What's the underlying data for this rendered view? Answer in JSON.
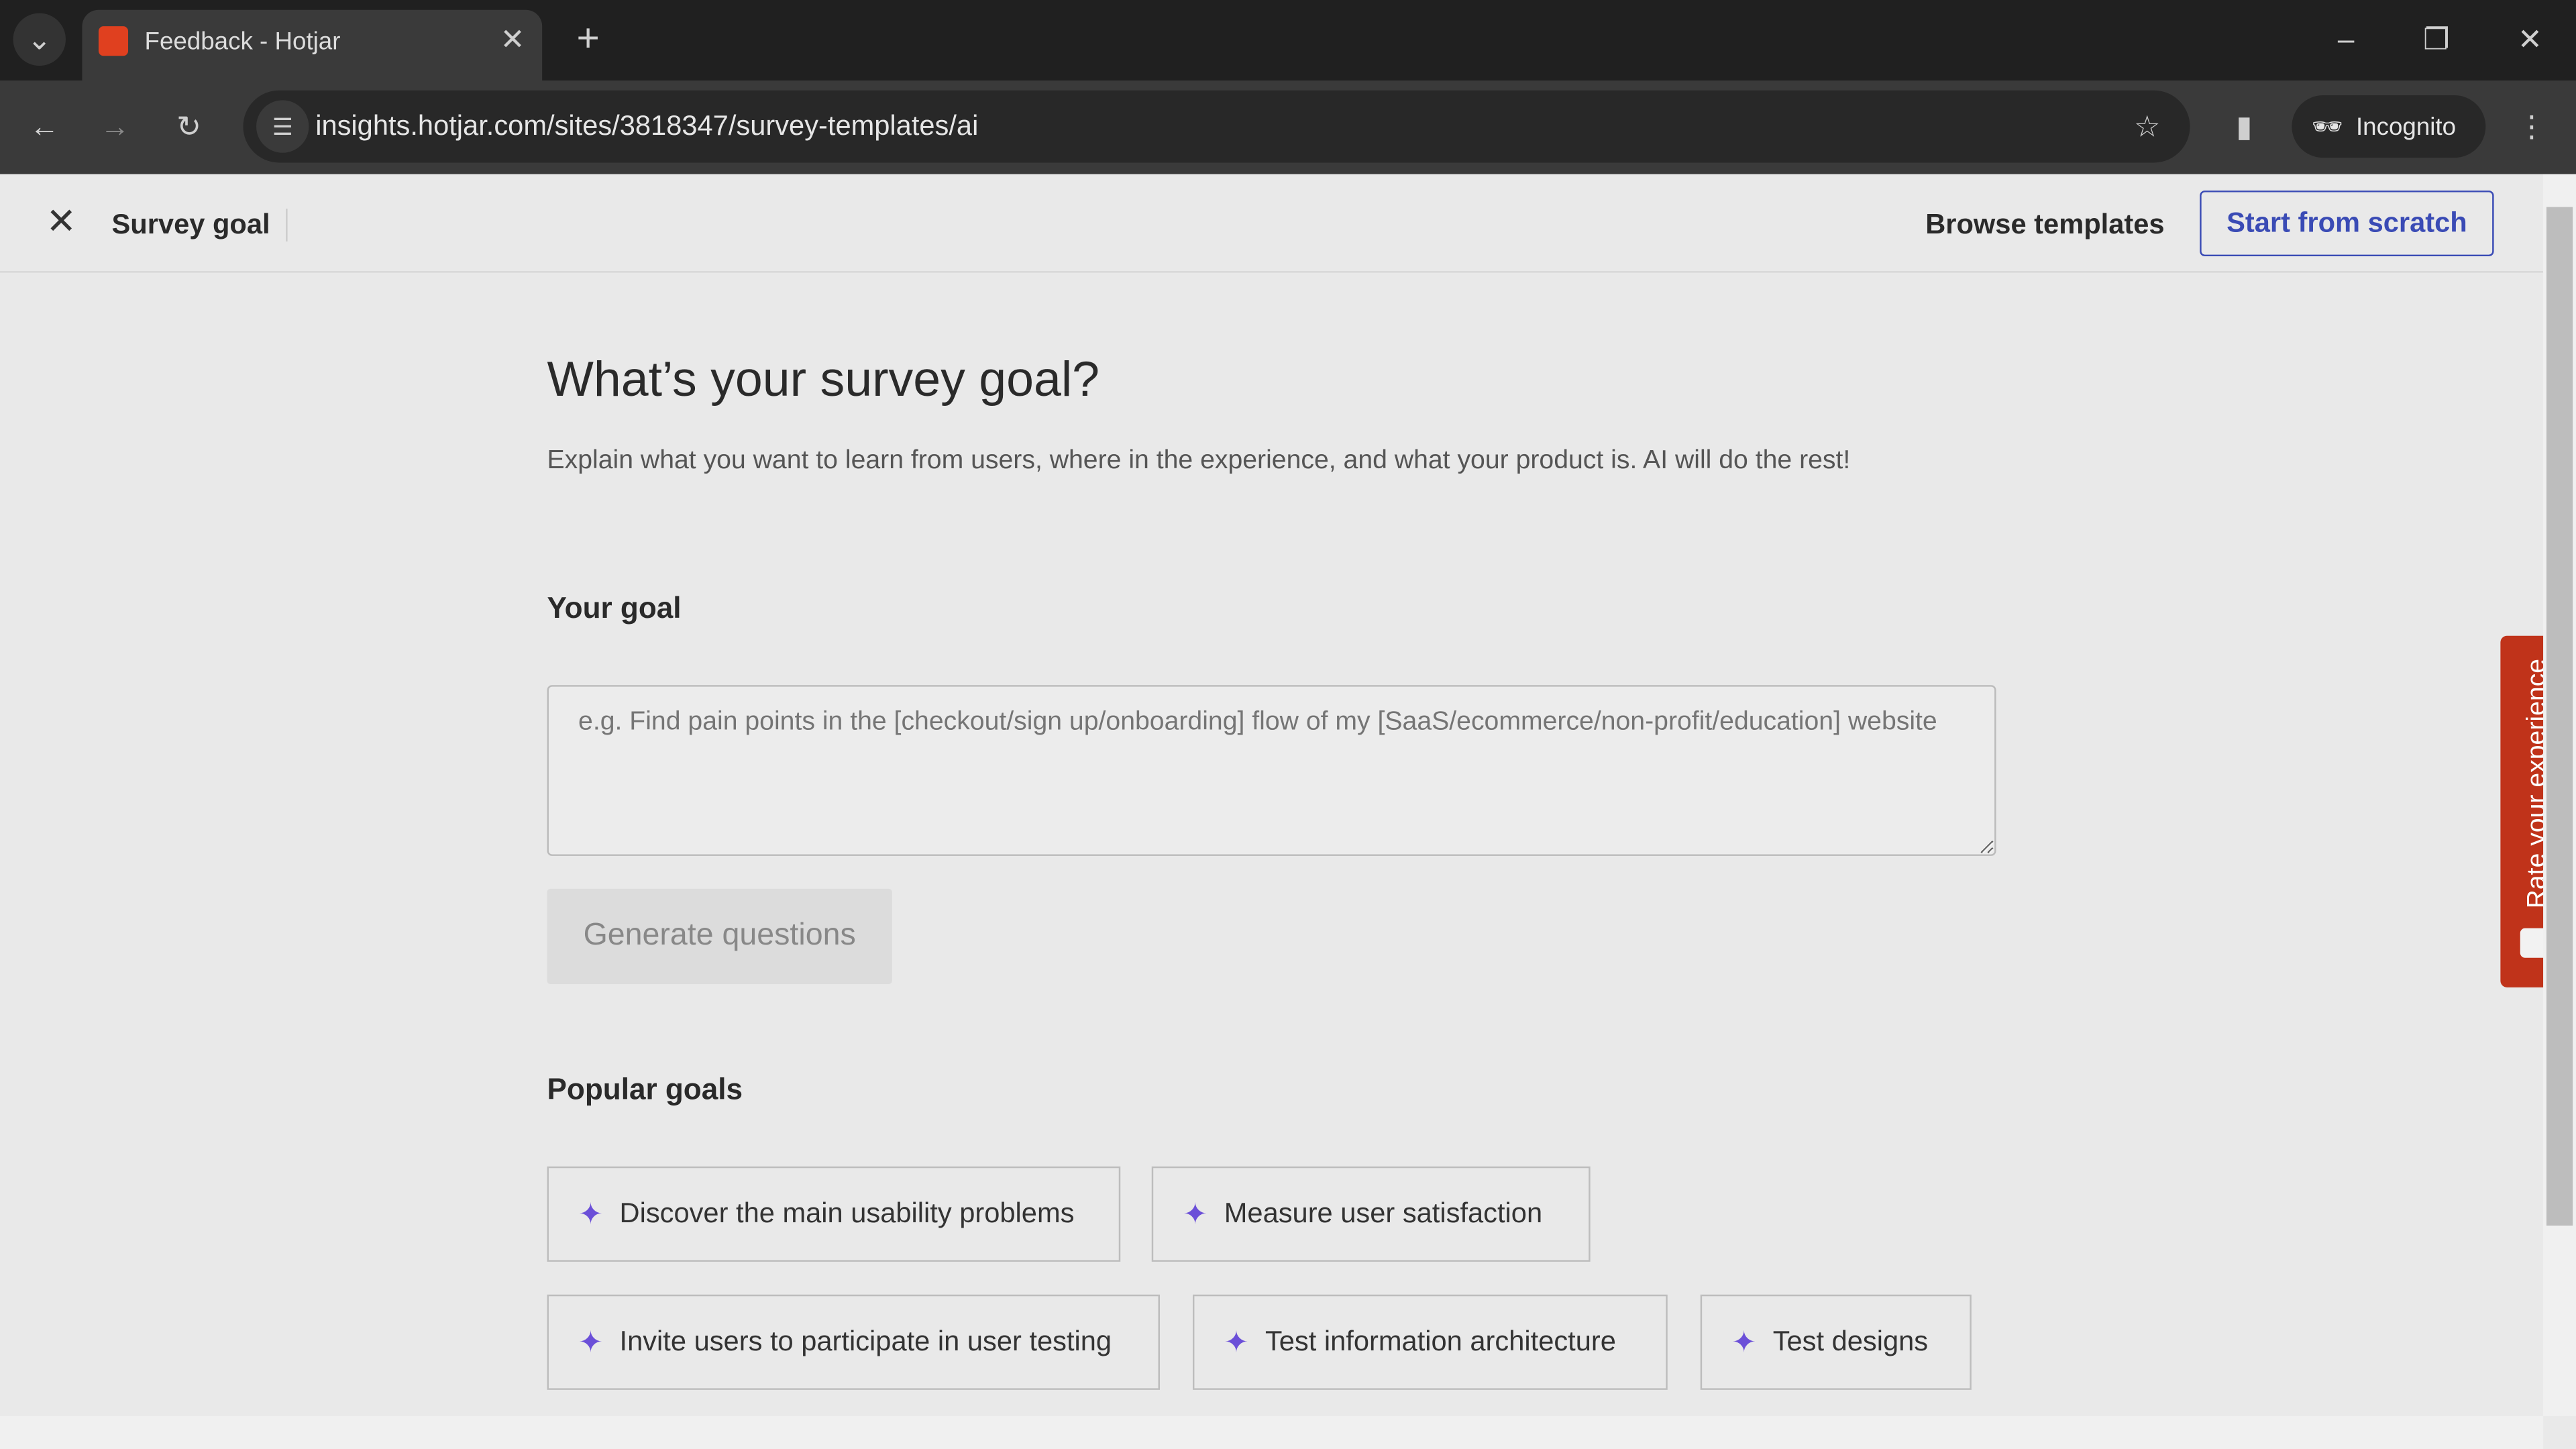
{
  "browser": {
    "tab_title": "Feedback - Hotjar",
    "url": "insights.hotjar.com/sites/3818347/survey-templates/ai",
    "incognito": "Incognito"
  },
  "header": {
    "title": "Survey goal",
    "browse": "Browse templates",
    "scratch": "Start from scratch"
  },
  "main": {
    "heading": "What’s your survey goal?",
    "subtitle": "Explain what you want to learn from users, where in the experience, and what your product is. AI will do the rest!",
    "goal_label": "Your goal",
    "goal_placeholder": "e.g. Find pain points in the [checkout/sign up/onboarding] flow of my [SaaS/ecommerce/non-profit/education] website",
    "generate": "Generate questions",
    "popular_label": "Popular goals",
    "popular": [
      "Discover the main usability problems",
      "Measure user satisfaction",
      "Invite users to participate in user testing",
      "Test information architecture",
      "Test designs"
    ]
  },
  "feedback_tab": {
    "label": "Rate your experience",
    "color": "#c0331a"
  },
  "colors": {
    "accent": "#3a4bb5",
    "spark": "#6b4fd8"
  }
}
